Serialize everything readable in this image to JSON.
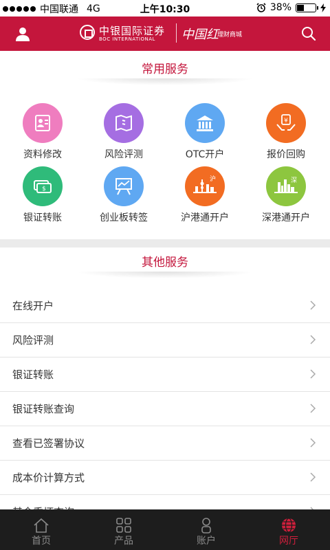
{
  "status_bar": {
    "carrier": "中国联通",
    "network": "4G",
    "time": "上午10:30",
    "battery": "38%",
    "battery_level": 0.38
  },
  "header": {
    "brand_cn": "中银国际证券",
    "brand_en": "BOC INTERNATIONAL",
    "brand_red": "中国红",
    "brand_mall": "理财商城",
    "user_icon": "user-icon",
    "search_icon": "search-icon"
  },
  "common_services": {
    "title": "常用服务",
    "items": [
      {
        "label": "资料修改",
        "icon": "profile-edit-icon",
        "color": "#ef7dbf"
      },
      {
        "label": "风险评测",
        "icon": "risk-assessment-icon",
        "color": "#a56ee2"
      },
      {
        "label": "OTC开户",
        "icon": "bank-building-icon",
        "color": "#5fa8f2"
      },
      {
        "label": "报价回购",
        "icon": "yuan-hands-icon",
        "color": "#f26c22"
      },
      {
        "label": "银证转账",
        "icon": "money-transfer-icon",
        "color": "#2fbb7a"
      },
      {
        "label": "创业板转签",
        "icon": "board-chart-icon",
        "color": "#5fa8f2"
      },
      {
        "label": "沪港通开户",
        "icon": "shanghai-skyline-icon",
        "color": "#f26c22"
      },
      {
        "label": "深港通开户",
        "icon": "shenzhen-skyline-icon",
        "color": "#8dc63f"
      }
    ]
  },
  "other_services": {
    "title": "其他服务",
    "items": [
      {
        "label": "在线开户"
      },
      {
        "label": "风险评测"
      },
      {
        "label": "银证转账"
      },
      {
        "label": "银证转账查询"
      },
      {
        "label": "查看已签署协议"
      },
      {
        "label": "成本价计算方式"
      },
      {
        "label": "基金乘坏查询"
      }
    ]
  },
  "tab_bar": {
    "tabs": [
      {
        "label": "首页",
        "icon": "home-icon",
        "active": false
      },
      {
        "label": "产品",
        "icon": "grid-icon",
        "active": false
      },
      {
        "label": "账户",
        "icon": "account-icon",
        "active": false
      },
      {
        "label": "网厅",
        "icon": "globe-icon",
        "active": true
      }
    ]
  },
  "colors": {
    "brand_red": "#c4163c",
    "tab_bg": "#1d1d1d",
    "active_tab": "#d01f3c"
  }
}
